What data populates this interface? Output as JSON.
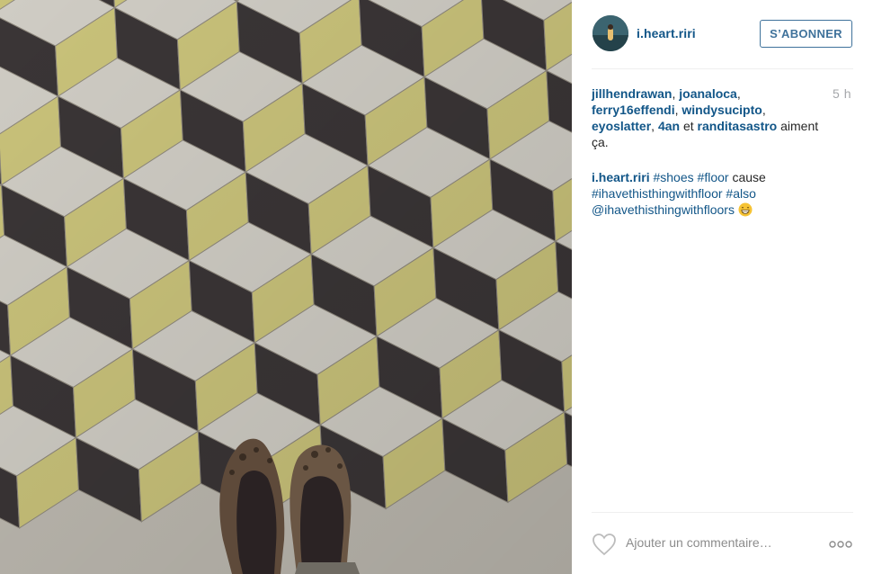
{
  "post": {
    "photo_alt": "",
    "author": {
      "username": "i.heart.riri",
      "follow_label": "S’ABONNER"
    },
    "time_ago": "5 h",
    "likes": {
      "users": [
        "jillhendrawan",
        "joanaloca",
        "ferry16effendi",
        "windysucipto",
        "eyoslatter",
        "4an",
        "randitasastro"
      ],
      "sep1": ", ",
      "and_word": " et ",
      "suffix": " aiment ça."
    },
    "caption": {
      "author": "i.heart.riri",
      "hashtag_shoes": "#shoes",
      "hashtag_floor": "#floor",
      "word_cause": " cause ",
      "hashtag_ihave": "#ihavethisthingwithfloor",
      "hashtag_also": "#also",
      "mention": "@ihavethisthingwithfloors"
    },
    "comment": {
      "placeholder": "Ajouter un commentaire…"
    }
  },
  "colors": {
    "link": "#125688",
    "follow": "#3f729b",
    "tile_light": "#cfccc4",
    "tile_dark": "#3a3536",
    "tile_gold": "#c9c27a"
  },
  "icons": [
    "heart-icon",
    "more-options-icon",
    "grin-emoji-icon"
  ]
}
